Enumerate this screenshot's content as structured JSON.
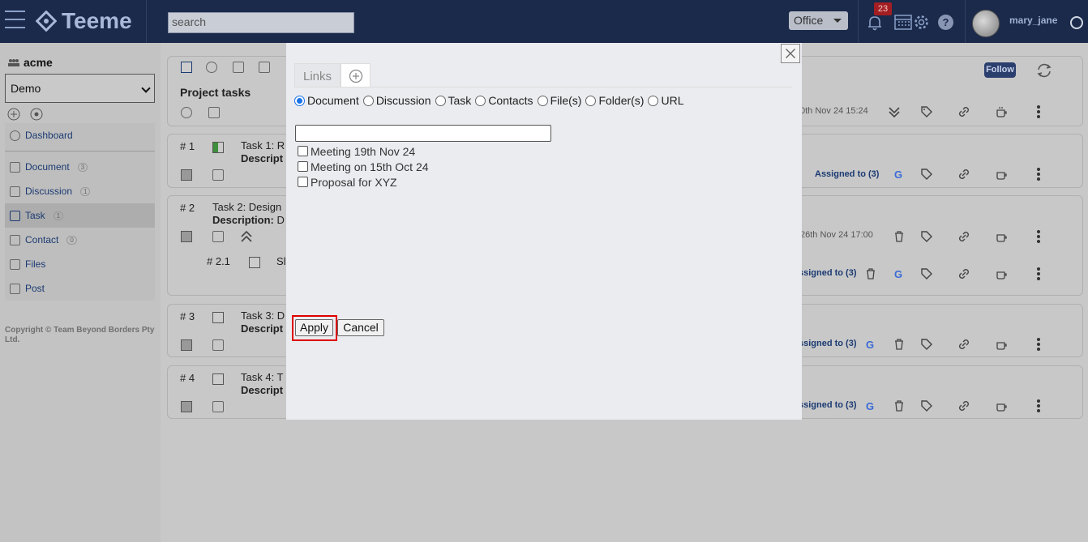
{
  "app": {
    "name": "Teeme"
  },
  "header": {
    "search_placeholder": "search",
    "space_selector": "Office",
    "notification_count": "23",
    "username": "mary_jane"
  },
  "sidebar": {
    "org_name": "acme",
    "selected_space": "Demo",
    "items": [
      {
        "label": "Dashboard",
        "count": ""
      },
      {
        "label": "Document",
        "count": "3"
      },
      {
        "label": "Discussion",
        "count": "1"
      },
      {
        "label": "Task",
        "count": "1"
      },
      {
        "label": "Contact",
        "count": "0"
      },
      {
        "label": "Files",
        "count": ""
      },
      {
        "label": "Post",
        "count": ""
      }
    ],
    "copyright": "Copyright © Team Beyond Borders Pty Ltd."
  },
  "main": {
    "section_title": "Project tasks",
    "follow_label": "Follow",
    "header_date": "0th Nov 24 15:24",
    "tasks": [
      {
        "num": "# 1",
        "title": "Task 1: R",
        "desc": "Descript",
        "meta": "Assigned to (3)"
      },
      {
        "num": "# 2",
        "title": "Task 2: Design",
        "desc_label": "Description:",
        "desc": "D",
        "date": "26th Nov 24 17:00"
      },
      {
        "num": "# 2.1",
        "title": "Sl",
        "meta": "ssigned to (3)"
      },
      {
        "num": "# 3",
        "title": "Task 3: D",
        "desc": "Descript",
        "meta": "ssigned to (3)"
      },
      {
        "num": "# 4",
        "title": "Task 4: T",
        "desc": "Descript",
        "meta": "ssigned to (3)"
      }
    ]
  },
  "modal": {
    "tab_links": "Links",
    "link_types": [
      "Document",
      "Discussion",
      "Task",
      "Contacts",
      "File(s)",
      "Folder(s)",
      "URL"
    ],
    "selected_type": "Document",
    "filter_value": "",
    "options": [
      "Meeting 19th Nov 24",
      "Meeting on 15th Oct 24",
      "Proposal for XYZ"
    ],
    "apply_label": "Apply",
    "cancel_label": "Cancel"
  },
  "colors": {
    "navbar": "#1b2a4a",
    "highlight": "#e00000",
    "radio_selected": "#1a73e8"
  }
}
